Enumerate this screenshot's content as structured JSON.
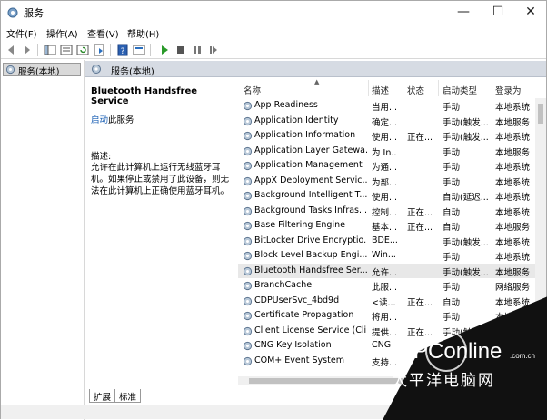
{
  "window": {
    "title": "服务"
  },
  "titlebar": {
    "min": "—",
    "max": "☐",
    "close": "✕"
  },
  "menu": [
    "文件(F)",
    "操作(A)",
    "查看(V)",
    "帮助(H)"
  ],
  "tree": {
    "selected": "服务(本地)"
  },
  "pane": {
    "title": "服务(本地)"
  },
  "details": {
    "service_name": "Bluetooth Handsfree Service",
    "start_link": "启动",
    "start_suffix": "此服务",
    "desc_label": "描述:",
    "desc_text": "允许在此计算机上运行无线蓝牙耳机。如果停止或禁用了此设备，则无法在此计算机上正确使用蓝牙耳机。"
  },
  "table": {
    "columns": [
      "名称",
      "描述",
      "状态",
      "启动类型",
      "登录为"
    ],
    "rows": [
      {
        "name": "App Readiness",
        "desc": "当用...",
        "status": "",
        "startup": "手动",
        "logon": "本地系统"
      },
      {
        "name": "Application Identity",
        "desc": "确定...",
        "status": "",
        "startup": "手动(触发...",
        "logon": "本地服务"
      },
      {
        "name": "Application Information",
        "desc": "使用...",
        "status": "正在...",
        "startup": "手动(触发...",
        "logon": "本地系统"
      },
      {
        "name": "Application Layer Gatewa...",
        "desc": "为 In...",
        "status": "",
        "startup": "手动",
        "logon": "本地服务"
      },
      {
        "name": "Application Management",
        "desc": "为通...",
        "status": "",
        "startup": "手动",
        "logon": "本地系统"
      },
      {
        "name": "AppX Deployment Servic...",
        "desc": "为部...",
        "status": "",
        "startup": "手动",
        "logon": "本地系统"
      },
      {
        "name": "Background Intelligent T...",
        "desc": "使用...",
        "status": "",
        "startup": "自动(延迟...",
        "logon": "本地系统"
      },
      {
        "name": "Background Tasks Infras...",
        "desc": "控制...",
        "status": "正在...",
        "startup": "自动",
        "logon": "本地系统"
      },
      {
        "name": "Base Filtering Engine",
        "desc": "基本...",
        "status": "正在...",
        "startup": "自动",
        "logon": "本地服务"
      },
      {
        "name": "BitLocker Drive Encryptio...",
        "desc": "BDE...",
        "status": "",
        "startup": "手动(触发...",
        "logon": "本地系统"
      },
      {
        "name": "Block Level Backup Engi...",
        "desc": "Win...",
        "status": "",
        "startup": "手动",
        "logon": "本地系统"
      },
      {
        "name": "Bluetooth Handsfree Ser...",
        "desc": "允许...",
        "status": "",
        "startup": "手动(触发...",
        "logon": "本地服务"
      },
      {
        "name": "BranchCache",
        "desc": "此服...",
        "status": "",
        "startup": "手动",
        "logon": "网络服务"
      },
      {
        "name": "CDPUserSvc_4bd9d",
        "desc": "<读...",
        "status": "正在...",
        "startup": "自动",
        "logon": "本地系统"
      },
      {
        "name": "Certificate Propagation",
        "desc": "将用...",
        "status": "",
        "startup": "手动",
        "logon": "本地系统"
      },
      {
        "name": "Client License Service (Cli...",
        "desc": "提供...",
        "status": "正在...",
        "startup": "手动(触发...",
        "logon": "本地系统"
      },
      {
        "name": "CNG Key Isolation",
        "desc": "CNG",
        "status": "",
        "startup": "",
        "logon": ""
      },
      {
        "name": "COM+ Event System",
        "desc": "支持...",
        "status": "",
        "startup": "",
        "logon": ""
      }
    ]
  },
  "tabs": [
    "扩展",
    "标准"
  ],
  "watermark": {
    "brand": "PConline",
    "domain": ".com.cn",
    "cn": "太平洋电脑网"
  },
  "colors": {
    "header_bg": "#d6dbe3",
    "link": "#1a5fb4",
    "selected_row": "#e8e8e8"
  }
}
